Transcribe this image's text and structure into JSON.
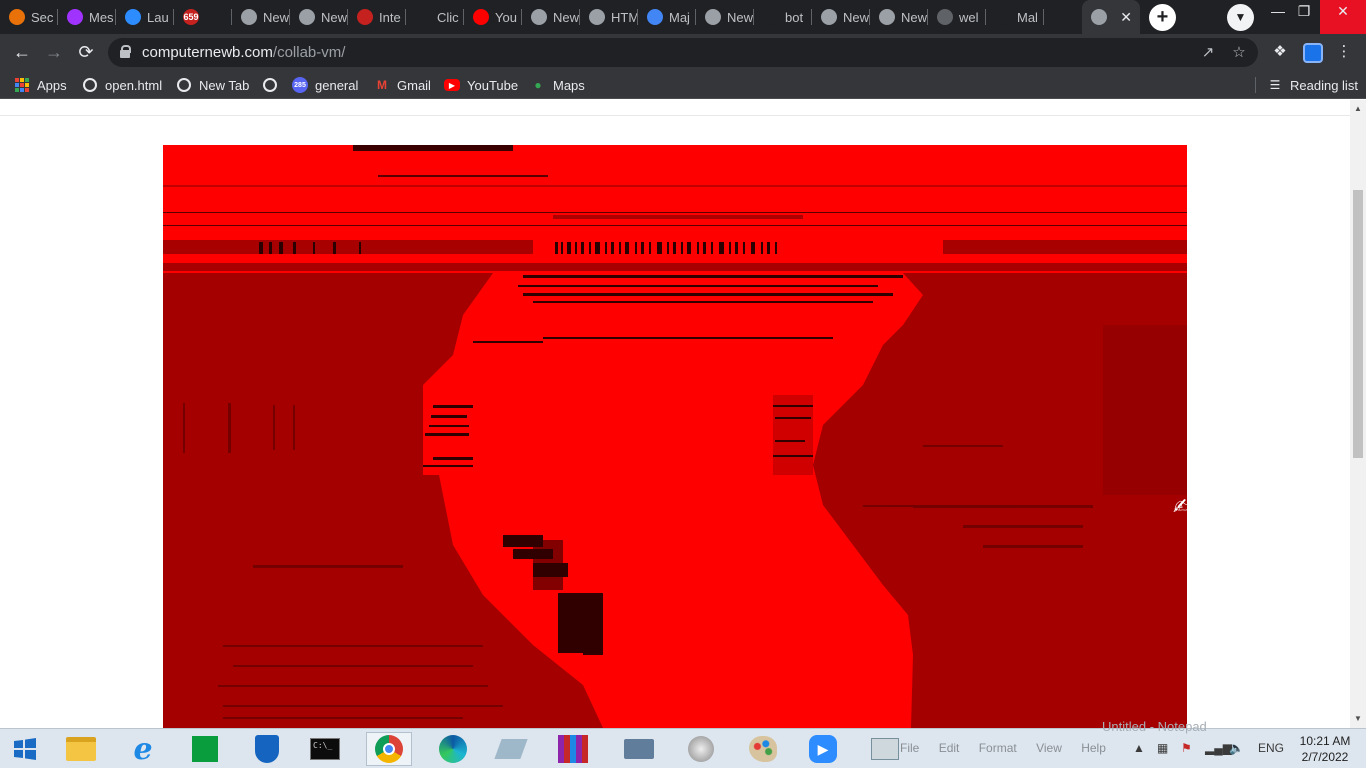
{
  "browser": {
    "tabs": [
      {
        "label": "Sec",
        "favicon": "search-icon",
        "color": "#e8710a",
        "glyph": ""
      },
      {
        "label": "Mes",
        "favicon": "messenger-icon",
        "color": "#a033ff",
        "glyph": ""
      },
      {
        "label": "Lau",
        "favicon": "zoom-icon",
        "color": "#2d8cff",
        "glyph": ""
      },
      {
        "label": "",
        "favicon": "badge-icon",
        "color": "#c5221f",
        "glyph": "659"
      },
      {
        "label": "New",
        "favicon": "chrome-icon",
        "color": "#9aa0a6",
        "glyph": ""
      },
      {
        "label": "New",
        "favicon": "chrome-icon",
        "color": "#9aa0a6",
        "glyph": ""
      },
      {
        "label": "Inte",
        "favicon": "speedometer-icon",
        "color": "#c5221f",
        "glyph": ""
      },
      {
        "label": "Clic",
        "favicon": "cursor-icon",
        "color": "#202124",
        "glyph": ""
      },
      {
        "label": "You",
        "favicon": "youtube-icon",
        "color": "#ff0000",
        "glyph": ""
      },
      {
        "label": "New",
        "favicon": "chrome-icon",
        "color": "#9aa0a6",
        "glyph": ""
      },
      {
        "label": "HTM",
        "favicon": "globe-icon",
        "color": "#9aa0a6",
        "glyph": ""
      },
      {
        "label": "Maj",
        "favicon": "shield-icon",
        "color": "#4285f4",
        "glyph": ""
      },
      {
        "label": "New",
        "favicon": "chrome-icon",
        "color": "#9aa0a6",
        "glyph": ""
      },
      {
        "label": "bot",
        "favicon": "openai-icon",
        "color": "#202124",
        "glyph": ""
      },
      {
        "label": "New",
        "favicon": "chrome-icon",
        "color": "#9aa0a6",
        "glyph": ""
      },
      {
        "label": "New",
        "favicon": "chrome-icon",
        "color": "#9aa0a6",
        "glyph": ""
      },
      {
        "label": "wel",
        "favicon": "globe-icon",
        "color": "#5f6368",
        "glyph": ""
      },
      {
        "label": "Mal",
        "favicon": "github-icon",
        "color": "#202124",
        "glyph": ""
      },
      {
        "label": "",
        "favicon": "computer-icon",
        "color": "#9aa0a6",
        "glyph": "",
        "active": true
      }
    ],
    "url_host": "computernewb.com",
    "url_path": "/collab-vm/",
    "bookmarks": [
      {
        "label": "Apps",
        "icon": "apps-icon"
      },
      {
        "label": "open.html",
        "icon": "globe-icon"
      },
      {
        "label": "New Tab",
        "icon": "globe-icon"
      },
      {
        "label": "",
        "icon": "globe-icon"
      },
      {
        "label": "general",
        "icon": "discord-badge-icon",
        "badge": "285"
      },
      {
        "label": "Gmail",
        "icon": "gmail-icon"
      },
      {
        "label": "YouTube",
        "icon": "youtube-icon"
      },
      {
        "label": "Maps",
        "icon": "maps-icon"
      }
    ],
    "reading_list": "Reading list"
  },
  "taskbar": {
    "items": [
      "start-icon",
      "file-explorer-icon",
      "internet-explorer-icon",
      "store-icon",
      "defender-icon",
      "command-prompt-icon",
      "chrome-icon",
      "edge-icon",
      "eraser-icon",
      "winrar-icon",
      "keyboard-icon",
      "speaker-icon",
      "paint-icon",
      "zoom-icon",
      "performance-monitor-icon"
    ],
    "ghost_notepad_title": "Untitled - Notepad",
    "ghost_notepad_menu": [
      "File",
      "Edit",
      "Format",
      "View",
      "Help"
    ],
    "language": "ENG",
    "time": "10:21 AM",
    "date": "2/7/2022"
  }
}
